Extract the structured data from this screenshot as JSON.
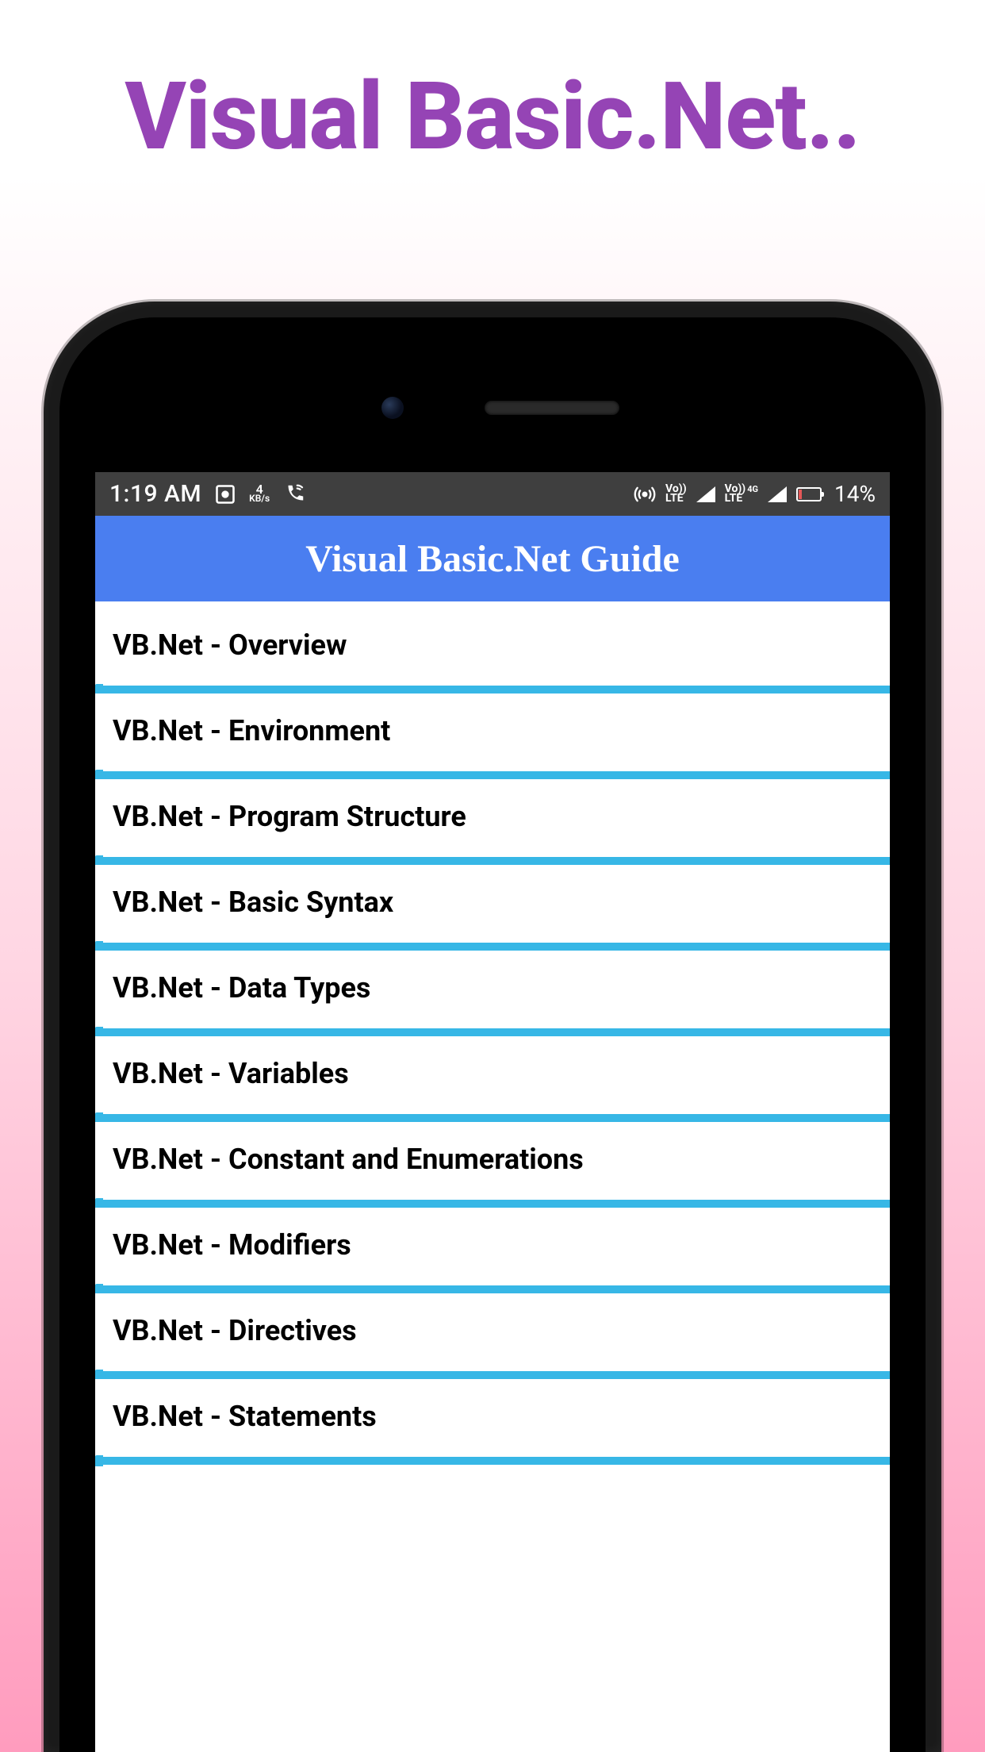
{
  "promo": {
    "title": "Visual Basic.Net.."
  },
  "statusbar": {
    "time": "1:19 AM",
    "data_rate_value": "4",
    "data_rate_unit": "KB/s",
    "network_label_1": "Vo))",
    "network_label_2": "LTE",
    "network_extra": "4G",
    "battery_percent": "14%"
  },
  "header": {
    "title": "Visual Basic.Net Guide"
  },
  "topics": {
    "items": [
      {
        "label": "VB.Net - Overview"
      },
      {
        "label": "VB.Net - Environment"
      },
      {
        "label": "VB.Net - Program Structure"
      },
      {
        "label": "VB.Net - Basic Syntax"
      },
      {
        "label": "VB.Net - Data Types"
      },
      {
        "label": "VB.Net - Variables"
      },
      {
        "label": "VB.Net - Constant and Enumerations"
      },
      {
        "label": "VB.Net - Modifiers"
      },
      {
        "label": "VB.Net - Directives"
      },
      {
        "label": "VB.Net - Statements"
      }
    ]
  }
}
